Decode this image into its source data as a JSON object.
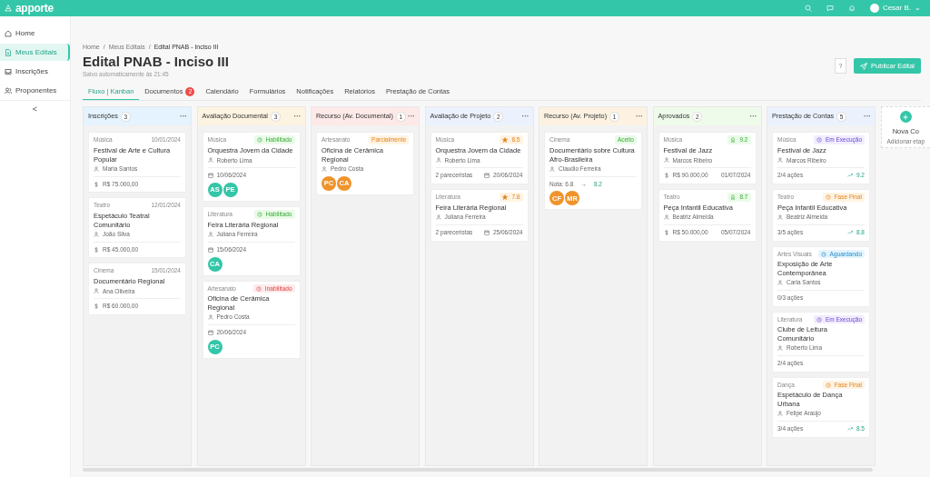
{
  "topbar": {
    "logo": "apporte",
    "user": "Cesar B.",
    "caret": "⌄"
  },
  "sidebar": {
    "items": [
      {
        "label": "Home",
        "selected": false
      },
      {
        "label": "Meus Editais",
        "selected": true
      },
      {
        "label": "Inscrições",
        "selected": false
      },
      {
        "label": "Proponentes",
        "selected": false
      }
    ],
    "collapse": "<"
  },
  "breadcrumb": [
    "Home",
    "Meus Editais",
    "Edital PNAB - Inciso III"
  ],
  "breadcrumb_separator": "/",
  "title": "Edital PNAB - Inciso III",
  "subtitle": "Salvo automaticamente às 21:45",
  "help_button": "?",
  "publish_button": "Publicar Edital",
  "tabs": [
    {
      "label": "Fluxo | Kanban",
      "selected": true
    },
    {
      "label": "Documentos",
      "badge": "2",
      "selected": false
    },
    {
      "label": "Calendário",
      "selected": false
    },
    {
      "label": "Formulários",
      "selected": false
    },
    {
      "label": "Notificações",
      "selected": false
    },
    {
      "label": "Relatórios",
      "selected": false
    },
    {
      "label": "Prestação de Contas",
      "selected": false
    }
  ],
  "columns": [
    {
      "title": "Inscrições",
      "count": "3",
      "menu": "···",
      "color": "#e4f3fd",
      "cards": [
        {
          "category": "Música",
          "date": "10/01/2024",
          "title": "Festival de Arte e Cultura Popular",
          "person": "Maria Santos",
          "footer": [
            {
              "kind": "amount",
              "text": "R$ 75.000,00"
            }
          ]
        },
        {
          "category": "Teatro",
          "date": "12/01/2024",
          "title": "Espetáculo Teatral Comunitário",
          "person": "João Silva",
          "footer": [
            {
              "kind": "amount",
              "text": "R$ 45.000,00"
            }
          ]
        },
        {
          "category": "Cinema",
          "date": "15/01/2024",
          "title": "Documentário Regional",
          "person": "Ana Oliveira",
          "footer": [
            {
              "kind": "amount",
              "text": "R$ 60.000,00"
            }
          ]
        }
      ]
    },
    {
      "title": "Avaliação Documental",
      "count": "3",
      "menu": "···",
      "color": "#fdf3e1",
      "cards": [
        {
          "category": "Música",
          "tag": {
            "text": "Habilitado",
            "kind": "success",
            "icon": true
          },
          "title": "Orquestra Jovem da Cidade",
          "person": "Roberto Lima",
          "footer": [
            {
              "kind": "date",
              "text": "10/06/2024"
            }
          ],
          "avatars": [
            {
              "initials": "AS",
              "color": "#34c6a8"
            },
            {
              "initials": "PE",
              "color": "#34c6a8"
            }
          ]
        },
        {
          "category": "Literatura",
          "tag": {
            "text": "Habilitado",
            "kind": "success",
            "icon": true
          },
          "title": "Feira Literária Regional",
          "person": "Juliana Ferreira",
          "footer": [
            {
              "kind": "date",
              "text": "15/06/2024"
            }
          ],
          "avatars": [
            {
              "initials": "CA",
              "color": "#34c6a8"
            }
          ]
        },
        {
          "category": "Artesanato",
          "tag": {
            "text": "Inabilitado",
            "kind": "danger",
            "icon": true
          },
          "title": "Oficina de Cerâmica Regional",
          "person": "Pedro Costa",
          "footer": [
            {
              "kind": "date",
              "text": "20/06/2024"
            }
          ],
          "avatars": [
            {
              "initials": "PC",
              "color": "#34c6a8"
            }
          ]
        }
      ]
    },
    {
      "title": "Recurso (Av. Documental)",
      "count": "1",
      "menu": "···",
      "color": "#fde9e7",
      "cards": [
        {
          "category": "Artesanato",
          "tag": {
            "text": "Parcialmente",
            "kind": "warning",
            "icon": false
          },
          "title": "Oficina de Cerâmica Regional",
          "person": "Pedro Costa",
          "avatars": [
            {
              "initials": "PC",
              "color": "#f0932b"
            },
            {
              "initials": "CA",
              "color": "#f0932b"
            }
          ]
        }
      ]
    },
    {
      "title": "Avaliação de Projeto",
      "count": "2",
      "menu": "···",
      "color": "#ebf1fd",
      "cards": [
        {
          "category": "Música",
          "score": {
            "kind": "star",
            "text": "8.5"
          },
          "title": "Orquestra Jovem da Cidade",
          "person": "Roberto Lima",
          "footer": [
            {
              "kind": "text",
              "text": "2 pareceristas"
            },
            {
              "kind": "date",
              "text": "20/06/2024"
            }
          ]
        },
        {
          "category": "Literatura",
          "score": {
            "kind": "star",
            "text": "7.8"
          },
          "title": "Feira Literária Regional",
          "person": "Juliana Ferreira",
          "footer": [
            {
              "kind": "text",
              "text": "2 pareceristas"
            },
            {
              "kind": "date",
              "text": "25/06/2024"
            }
          ]
        }
      ]
    },
    {
      "title": "Recurso (Av. Projeto)",
      "count": "1",
      "menu": "···",
      "color": "#fdf2e1",
      "cards": [
        {
          "category": "Cinema",
          "tag": {
            "text": "Aceito",
            "kind": "success",
            "icon": false
          },
          "title": "Documentário sobre Cultura Afro-Brasileira",
          "person": "Claudio Ferreira",
          "footer": [
            {
              "kind": "note",
              "text": "Nota: 6.8",
              "arrow": "→",
              "value": "8.2"
            }
          ],
          "avatars": [
            {
              "initials": "CF",
              "color": "#f0932b"
            },
            {
              "initials": "MR",
              "color": "#f0932b"
            }
          ]
        }
      ]
    },
    {
      "title": "Aprovados",
      "count": "2",
      "menu": "···",
      "color": "#effbea",
      "cards": [
        {
          "category": "Música",
          "score": {
            "kind": "award",
            "text": "9.2"
          },
          "title": "Festival de Jazz",
          "person": "Marcos Ribeiro",
          "footer": [
            {
              "kind": "amount",
              "text": "R$ 90.000,00"
            },
            {
              "kind": "text",
              "text": "01/07/2024"
            }
          ]
        },
        {
          "category": "Teatro",
          "score": {
            "kind": "award",
            "text": "8.7"
          },
          "title": "Peça Infantil Educativa",
          "person": "Beatriz Almeida",
          "footer": [
            {
              "kind": "amount",
              "text": "R$ 50.000,00"
            },
            {
              "kind": "text",
              "text": "05/07/2024"
            }
          ]
        }
      ]
    },
    {
      "title": "Prestação de Contas",
      "count": "5",
      "menu": "···",
      "color": "#ebf1fd",
      "cards": [
        {
          "category": "Música",
          "tag": {
            "text": "Em Execução",
            "kind": "purple",
            "icon": true
          },
          "title": "Festival de Jazz",
          "person": "Marcos Ribeiro",
          "footer": [
            {
              "kind": "text",
              "text": "2/4 ações"
            },
            {
              "kind": "trend",
              "text": "9.2"
            }
          ]
        },
        {
          "category": "Teatro",
          "tag": {
            "text": "Fase Final",
            "kind": "warning",
            "icon": true
          },
          "title": "Peça Infantil Educativa",
          "person": "Beatriz Almeida",
          "footer": [
            {
              "kind": "text",
              "text": "3/5 ações"
            },
            {
              "kind": "trend",
              "text": "8.8"
            }
          ]
        },
        {
          "category": "Artes Visuais",
          "tag": {
            "text": "Aguardando",
            "kind": "info",
            "icon": true
          },
          "title": "Exposição de Arte Contemporânea",
          "person": "Carla Santos",
          "footer": [
            {
              "kind": "text",
              "text": "0/3 ações"
            }
          ]
        },
        {
          "category": "Literatura",
          "tag": {
            "text": "Em Execução",
            "kind": "purple",
            "icon": true
          },
          "title": "Clube de Leitura Comunitário",
          "person": "Roberto Lima",
          "footer": [
            {
              "kind": "text",
              "text": "2/4 ações"
            }
          ]
        },
        {
          "category": "Dança",
          "tag": {
            "text": "Fase Final",
            "kind": "warning",
            "icon": true
          },
          "title": "Espetáculo de Dança Urbana",
          "person": "Felipe Araújo",
          "footer": [
            {
              "kind": "text",
              "text": "3/4 ações"
            },
            {
              "kind": "trend",
              "text": "8.5"
            }
          ]
        }
      ]
    }
  ],
  "new_column": {
    "title": "Nova Co",
    "hint": "Adicionar etap"
  }
}
